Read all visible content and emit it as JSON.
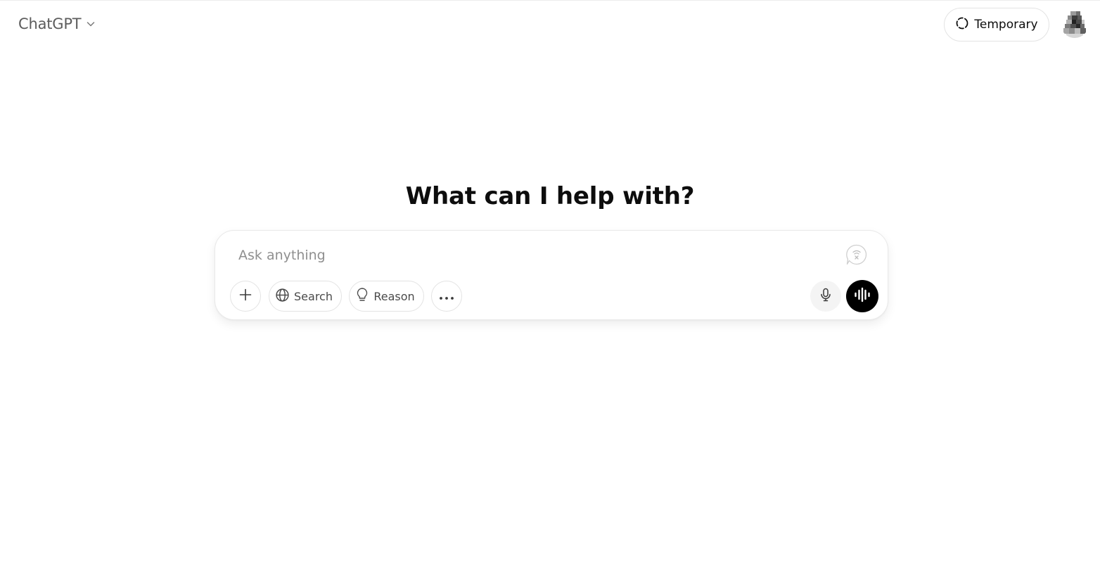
{
  "header": {
    "model_label": "ChatGPT",
    "temporary_label": "Temporary"
  },
  "main": {
    "headline": "What can I help with?"
  },
  "composer": {
    "placeholder": "Ask anything",
    "value": "",
    "tools": {
      "search_label": "Search",
      "reason_label": "Reason"
    }
  },
  "icons": {
    "model_menu": "chevron-down-icon",
    "temporary": "dashed-circle-icon",
    "attach": "plus-icon",
    "search": "globe-icon",
    "reason": "lightbulb-icon",
    "more": "ellipsis-icon",
    "badge": "speech-bubble-icon",
    "dictate": "microphone-icon",
    "voice": "voice-wave-icon"
  },
  "colors": {
    "background": "#ffffff",
    "text_primary": "#0d0d0d",
    "text_secondary": "#5d5d5d",
    "placeholder": "#8f8f8f",
    "border": "#e3e3e3",
    "voice_button": "#000000"
  }
}
